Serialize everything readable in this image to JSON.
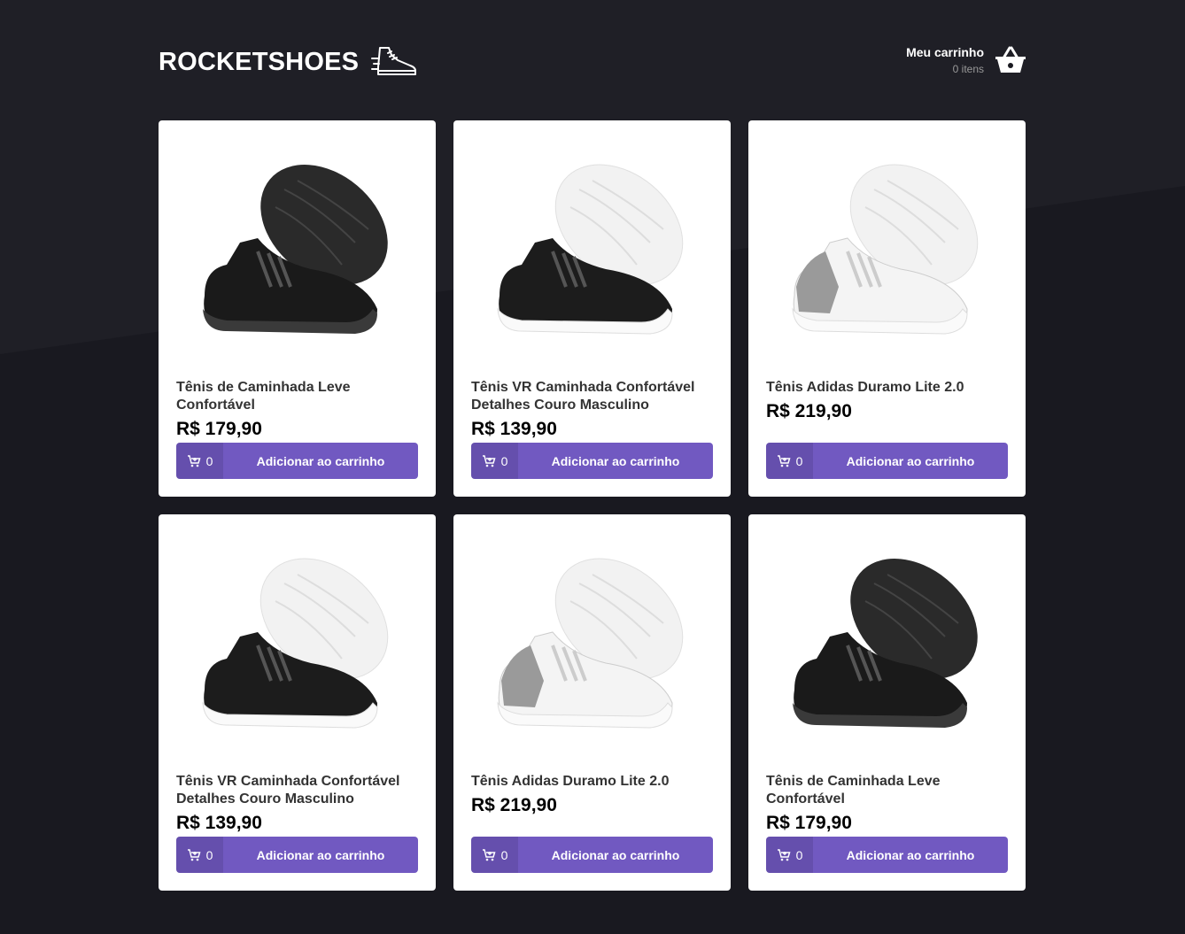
{
  "header": {
    "logo_text": "ROCKETSHOES",
    "cart_title": "Meu carrinho",
    "cart_count": "0 itens"
  },
  "products": [
    {
      "name": "Tênis de Caminhada Leve Confortável",
      "price": "R$ 179,90",
      "qty": "0",
      "button": "Adicionar ao carrinho",
      "colorway": "black"
    },
    {
      "name": "Tênis VR Caminhada Confortável Detalhes Couro Masculino",
      "price": "R$ 139,90",
      "qty": "0",
      "button": "Adicionar ao carrinho",
      "colorway": "black-white"
    },
    {
      "name": "Tênis Adidas Duramo Lite 2.0",
      "price": "R$ 219,90",
      "qty": "0",
      "button": "Adicionar ao carrinho",
      "colorway": "white-grey"
    },
    {
      "name": "Tênis VR Caminhada Confortável Detalhes Couro Masculino",
      "price": "R$ 139,90",
      "qty": "0",
      "button": "Adicionar ao carrinho",
      "colorway": "black-white"
    },
    {
      "name": "Tênis Adidas Duramo Lite 2.0",
      "price": "R$ 219,90",
      "qty": "0",
      "button": "Adicionar ao carrinho",
      "colorway": "white-grey"
    },
    {
      "name": "Tênis de Caminhada Leve Confortável",
      "price": "R$ 179,90",
      "qty": "0",
      "button": "Adicionar ao carrinho",
      "colorway": "black"
    }
  ],
  "colors": {
    "background": "#191920",
    "accent": "#7159c1",
    "card": "#ffffff"
  }
}
